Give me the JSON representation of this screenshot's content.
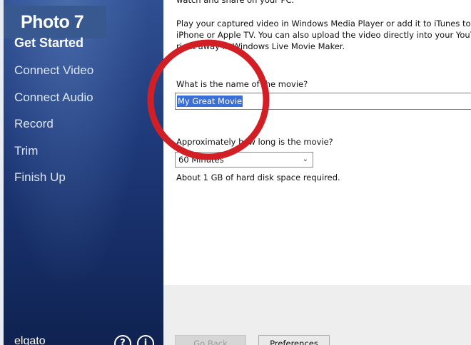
{
  "photo_label": "Photo 7",
  "sidebar": {
    "items": [
      {
        "label": "Get Started",
        "active": true
      },
      {
        "label": "Connect Video",
        "active": false
      },
      {
        "label": "Connect Audio",
        "active": false
      },
      {
        "label": "Record",
        "active": false
      },
      {
        "label": "Trim",
        "active": false
      },
      {
        "label": "Finish Up",
        "active": false
      }
    ],
    "brand": "elgato",
    "help_icon_glyph": "?",
    "info_icon_glyph": "i"
  },
  "content": {
    "intro_line_1": "watch and share on your PC.",
    "intro_lines_2": [
      "Play your captured video in Windows Media Player or add it to iTunes to sync",
      "iPhone or Apple TV. You can also upload the video directly into your YouTube",
      "right away in Windows Live Movie Maker."
    ],
    "name_label": "What is the name of the movie?",
    "name_value": "My Great Movie",
    "length_label": "Approximately how long is the movie?",
    "length_value": "60 Minutes",
    "disk_text": "About 1 GB of hard disk space required."
  },
  "buttons": {
    "back_label": "Go Back",
    "prefs_label": "Preferences"
  },
  "colors": {
    "sidebar_navy": "#1f3a7a",
    "selection_blue": "#3b6fd8",
    "annotation_red": "#d21f26"
  }
}
